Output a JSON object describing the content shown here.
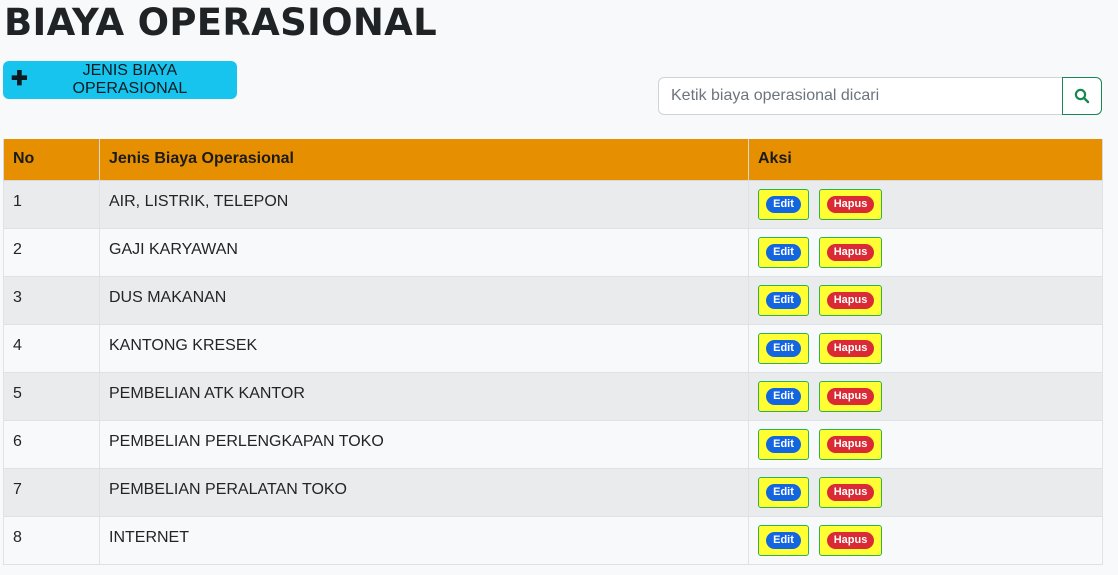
{
  "page": {
    "title": "BIAYA OPERASIONAL"
  },
  "toolbar": {
    "add_label": "JENIS BIAYA OPERASIONAL",
    "add_icon": "plus-icon"
  },
  "search": {
    "placeholder": "Ketik biaya operasional dicari",
    "value": "",
    "button_icon": "search-icon"
  },
  "table": {
    "headers": [
      "No",
      "Jenis Biaya Operasional",
      "Aksi"
    ],
    "edit_label": "Edit",
    "delete_label": "Hapus",
    "rows": [
      {
        "no": "1",
        "name": "AIR, LISTRIK, TELEPON"
      },
      {
        "no": "2",
        "name": "GAJI KARYAWAN"
      },
      {
        "no": "3",
        "name": "DUS MAKANAN"
      },
      {
        "no": "4",
        "name": "KANTONG KRESEK"
      },
      {
        "no": "5",
        "name": "PEMBELIAN ATK KANTOR"
      },
      {
        "no": "6",
        "name": "PEMBELIAN PERLENGKAPAN TOKO"
      },
      {
        "no": "7",
        "name": "PEMBELIAN PERALATAN TOKO"
      },
      {
        "no": "8",
        "name": "INTERNET"
      }
    ]
  },
  "colors": {
    "header_bg": "#e68f00",
    "add_button_bg": "#17c4ee",
    "action_button_bg": "#ffff33",
    "edit_pill": "#1366e0",
    "delete_pill": "#d92a36",
    "search_button_border": "#198754"
  }
}
